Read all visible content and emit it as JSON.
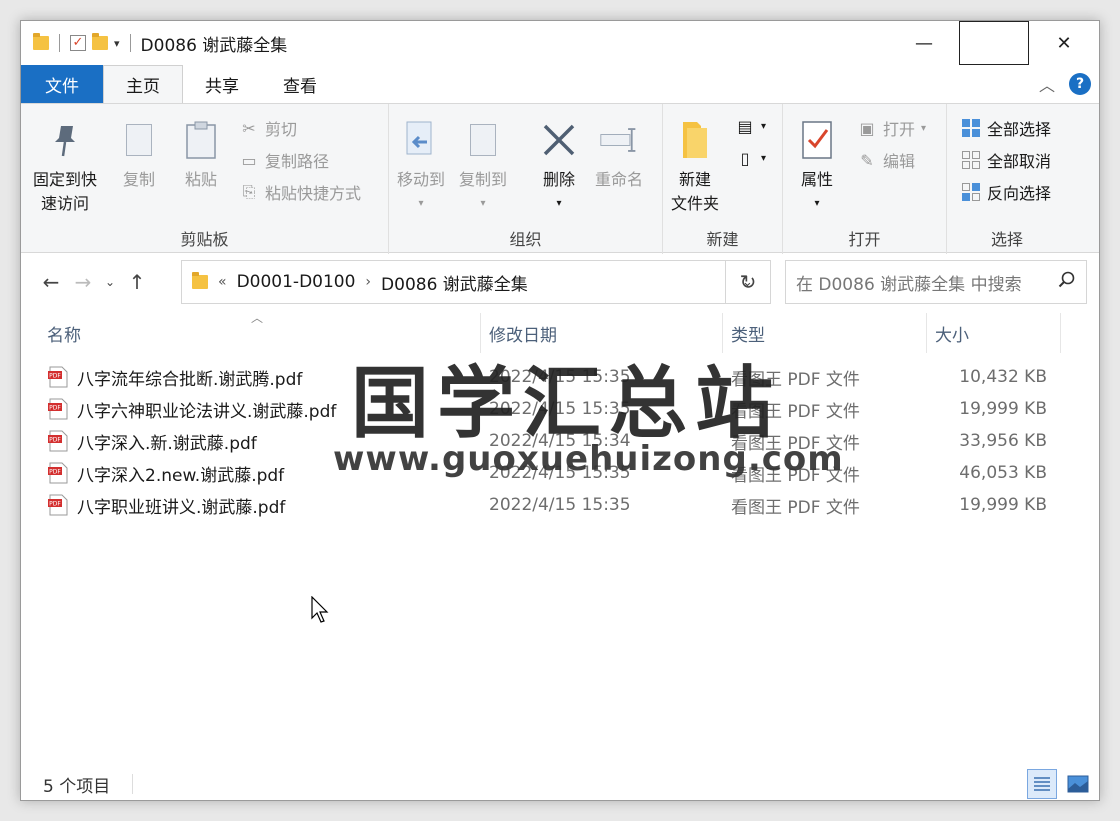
{
  "window": {
    "title": "D0086 谢武藤全集"
  },
  "tabs": {
    "file": "文件",
    "home": "主页",
    "share": "共享",
    "view": "查看"
  },
  "ribbon": {
    "clipboard": {
      "label": "剪贴板",
      "pin": "固定到快\n速访问",
      "pin_l1": "固定到快",
      "pin_l2": "速访问",
      "copy": "复制",
      "paste": "粘贴",
      "cut": "剪切",
      "copy_path": "复制路径",
      "paste_shortcut": "粘贴快捷方式"
    },
    "organize": {
      "label": "组织",
      "move_to": "移动到",
      "copy_to": "复制到",
      "delete": "删除",
      "rename": "重命名"
    },
    "new": {
      "label": "新建",
      "new_folder_l1": "新建",
      "new_folder_l2": "文件夹"
    },
    "open": {
      "label": "打开",
      "properties": "属性",
      "open": "打开",
      "edit": "编辑"
    },
    "select": {
      "label": "选择",
      "select_all": "全部选择",
      "select_none": "全部取消",
      "invert": "反向选择"
    }
  },
  "address": {
    "overflow": "«",
    "crumbs": [
      "D0001-D0100",
      "D0086 谢武藤全集"
    ],
    "search_placeholder": "在 D0086 谢武藤全集 中搜索"
  },
  "columns": {
    "name": "名称",
    "date": "修改日期",
    "type": "类型",
    "size": "大小"
  },
  "files": [
    {
      "name": "八字流年综合批断.谢武腾.pdf",
      "date": "2022/4/15 15:35",
      "type": "看图王 PDF 文件",
      "size": "10,432 KB"
    },
    {
      "name": "八字六神职业论法讲义.谢武藤.pdf",
      "date": "2022/4/15 15:35",
      "type": "看图王 PDF 文件",
      "size": "19,999 KB"
    },
    {
      "name": "八字深入.新.谢武藤.pdf",
      "date": "2022/4/15 15:34",
      "type": "看图王 PDF 文件",
      "size": "33,956 KB"
    },
    {
      "name": "八字深入2.new.谢武藤.pdf",
      "date": "2022/4/15 15:35",
      "type": "看图王 PDF 文件",
      "size": "46,053 KB"
    },
    {
      "name": "八字职业班讲义.谢武藤.pdf",
      "date": "2022/4/15 15:35",
      "type": "看图王 PDF 文件",
      "size": "19,999 KB"
    }
  ],
  "watermark": {
    "title": "国学汇总站",
    "url": "www.guoxuehuizong.com"
  },
  "status": {
    "count": "5 个项目"
  },
  "colors": {
    "accent": "#1a6fc4",
    "pdf_red": "#d32f2f",
    "folder": "#f5c242"
  }
}
